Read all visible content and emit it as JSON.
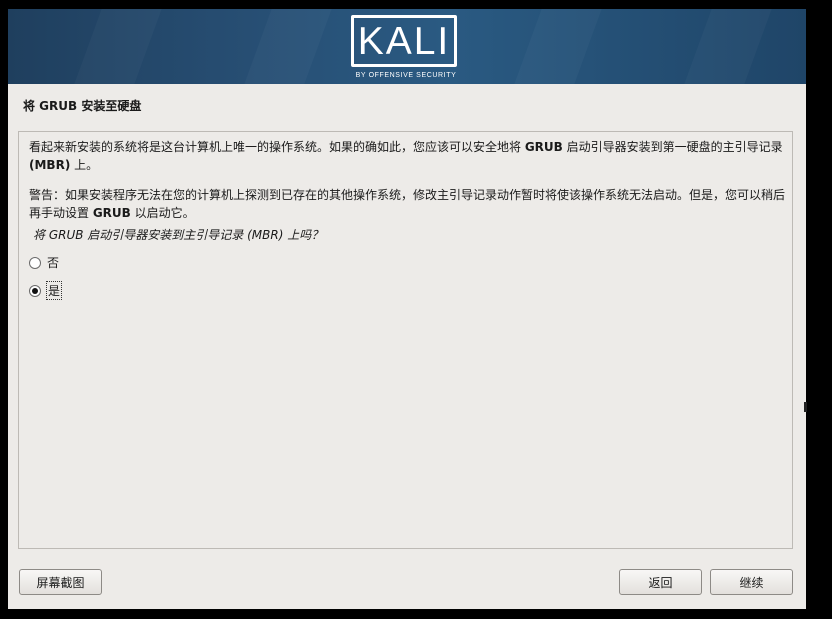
{
  "banner": {
    "logo_text": "KALI",
    "logo_sub": "BY OFFENSIVE SECURITY",
    "colors": {
      "banner": "#274e73",
      "logo": "#ffffff"
    }
  },
  "page": {
    "title": "将 GRUB 安装至硬盘",
    "p1_a": "看起来新安装的系统将是这台计算机上唯一的操作系统。如果的确如此，您应该可以安全地将 ",
    "p1_b": "GRUB",
    "p1_c": " 启动引导器安装到第一硬盘的主引导记录",
    "p1_d": "(MBR)",
    "p1_e": " 上。",
    "p2_a": "警告：如果安装程序无法在您的计算机上探测到已存在的其他操作系统，修改主引导记录动作暂时将使该操作系统无法启动。但是，您可以稍后再手动设置 ",
    "p2_b": "GRUB",
    "p2_c": " 以启动它。",
    "question": "将 GRUB 启动引导器安装到主引导记录 (MBR) 上吗？",
    "options": [
      {
        "label": "否",
        "selected": false
      },
      {
        "label": "是",
        "selected": true
      }
    ]
  },
  "buttons": {
    "screenshot": "屏幕截图",
    "back": "返回",
    "continue": "继续"
  }
}
